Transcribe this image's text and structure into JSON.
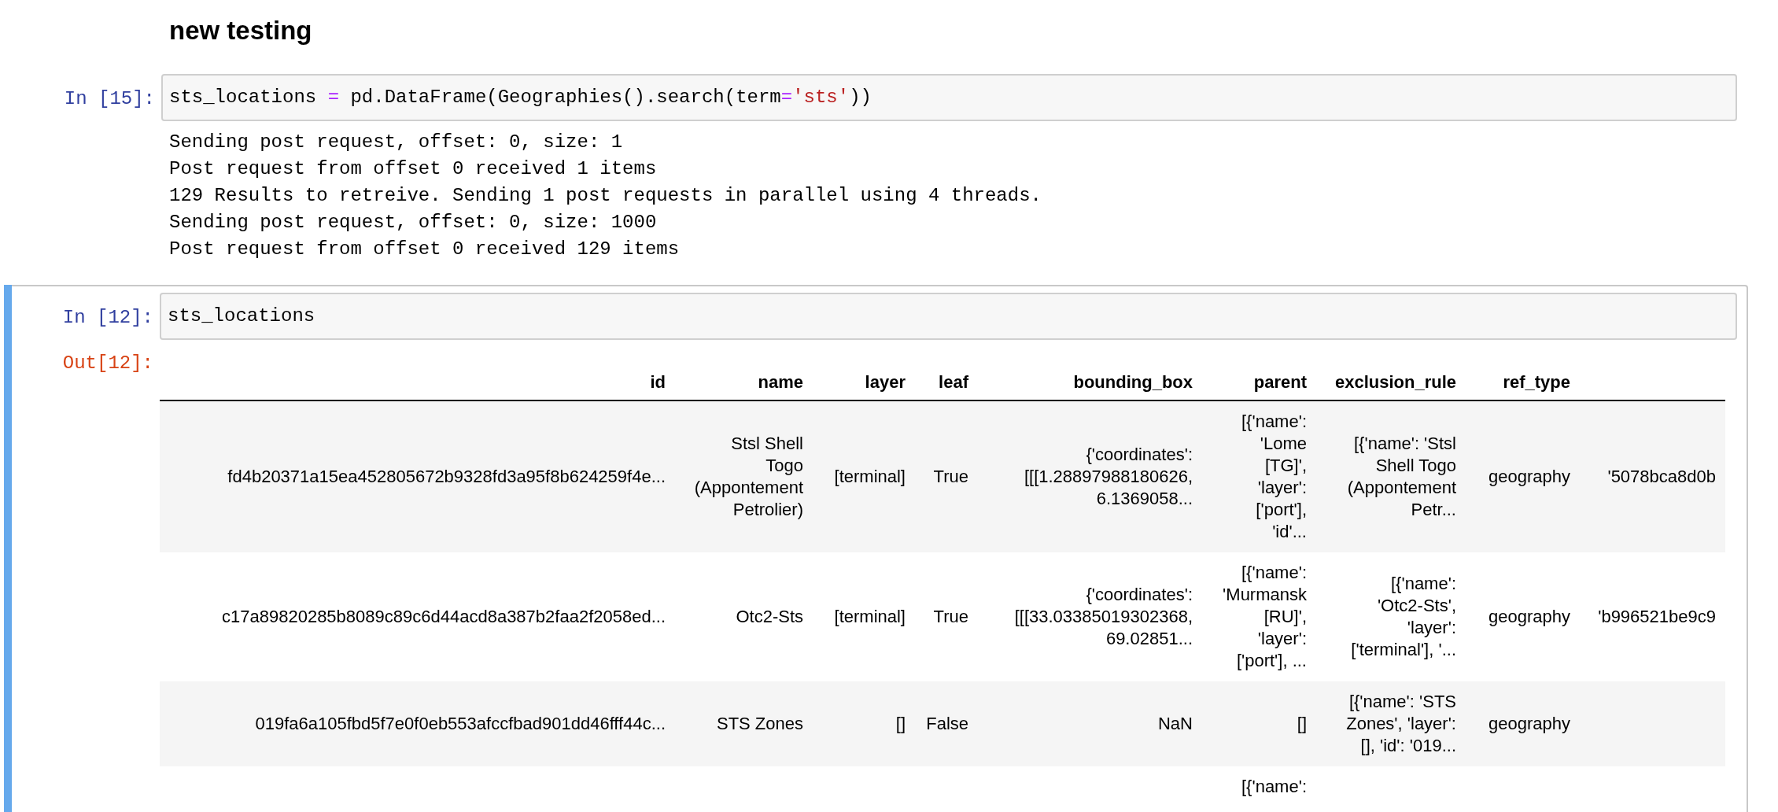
{
  "heading": "new testing",
  "cells": [
    {
      "prompt": "In [15]:",
      "selected": false,
      "code": [
        {
          "kind": "plain",
          "text": "sts_locations "
        },
        {
          "kind": "operator",
          "text": "="
        },
        {
          "kind": "plain",
          "text": " pd.DataFrame(Geographies().search(term"
        },
        {
          "kind": "operator",
          "text": "="
        },
        {
          "kind": "string",
          "text": "'sts'"
        },
        {
          "kind": "plain",
          "text": "))"
        }
      ],
      "output_lines": [
        "Sending post request, offset: 0, size: 1",
        "Post request from offset 0 received 1 items",
        "129 Results to retreive. Sending 1 post requests in parallel using 4 threads.",
        "Sending post request, offset: 0, size: 1000",
        "Post request from offset 0 received 129 items"
      ]
    },
    {
      "prompt": "In [12]:",
      "selected": true,
      "code": [
        {
          "kind": "plain",
          "text": "sts_locations"
        }
      ],
      "out_prompt": "Out[12]:",
      "table": {
        "columns": [
          "id",
          "name",
          "layer",
          "leaf",
          "bounding_box",
          "parent",
          "exclusion_rule",
          "ref_type"
        ],
        "rows": [
          {
            "cells": [
              "fd4b20371a15ea452805672b9328fd3a95f8b624259f4e...",
              "Stsl Shell\nTogo\n(Appontement\nPetrolier)",
              "[terminal]",
              "True",
              "{'coordinates':\n[[[1.28897988180626,\n6.1369058...",
              "[{'name':\n'Lome\n[TG]',\n'layer':\n['port'],\n'id'...",
              "[{'name': 'Stsl\nShell Togo\n(Appontement\nPetr...",
              "geography",
              "'5078bca8d0b"
            ]
          },
          {
            "cells": [
              "c17a89820285b8089c89c6d44acd8a387b2faa2f2058ed...",
              "Otc2-Sts",
              "[terminal]",
              "True",
              "{'coordinates':\n[[[33.03385019302368,\n69.02851...",
              "[{'name':\n'Murmansk\n[RU]',\n'layer':\n['port'], ...",
              "[{'name':\n'Otc2-Sts',\n'layer':\n['terminal'], '...",
              "geography",
              "'b996521be9c9"
            ]
          },
          {
            "cells": [
              "019fa6a105fbd5f7e0f0eb553afccfbad901dd46fff44c...",
              "STS Zones",
              "[]",
              "False",
              "NaN",
              "[]",
              "[{'name': 'STS\nZones', 'layer':\n[], 'id': '019...",
              "geography",
              null
            ]
          },
          {
            "cells": [
              null,
              null,
              null,
              null,
              null,
              "[{'name':",
              null,
              null,
              null
            ]
          }
        ]
      }
    }
  ]
}
